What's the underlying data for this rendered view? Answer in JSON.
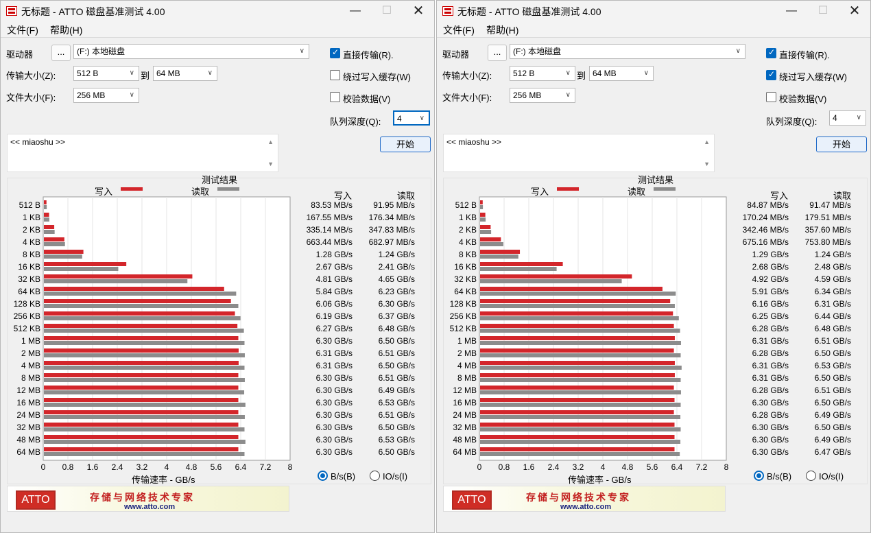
{
  "windows": [
    {
      "title": "无标题 - ATTO 磁盘基准测试 4.00",
      "menu": [
        "文件(F)",
        "帮助(H)"
      ],
      "drive_label": "驱动器",
      "browse_label": "...",
      "drive_value": "(F:) 本地磁盘",
      "transfer_size_label": "传输大小(Z):",
      "transfer_from": "512 B",
      "to_label": "到",
      "transfer_to": "64 MB",
      "file_size_label": "文件大小(F):",
      "file_size": "256 MB",
      "direct_io_label": "直接传输(R).",
      "direct_io_checked": true,
      "bypass_cache_label": "绕过写入缓存(W)",
      "bypass_cache_checked": false,
      "verify_label": "校验数据(V)",
      "verify_checked": false,
      "queue_depth_label": "队列深度(Q):",
      "queue_depth": "4",
      "start_label": "开始",
      "description": "<< miaoshu >>",
      "results_title": "测试结果",
      "write_label": "写入",
      "read_label": "读取",
      "col_write": "写入",
      "col_read": "读取",
      "xlabel": "传输速率 - GB/s",
      "radio_bps": "B/s(B)",
      "radio_ios": "IO/s(I)",
      "radio_selected": "bps",
      "banner_slogan": "存储与网络技术专家",
      "banner_logo": "ATTO",
      "banner_url": "www.atto.com",
      "chart_data": {
        "type": "bar",
        "orientation": "horizontal",
        "categories": [
          "512 B",
          "1 KB",
          "2 KB",
          "4 KB",
          "8 KB",
          "16 KB",
          "32 KB",
          "64 KB",
          "128 KB",
          "256 KB",
          "512 KB",
          "1 MB",
          "2 MB",
          "4 MB",
          "8 MB",
          "12 MB",
          "16 MB",
          "24 MB",
          "32 MB",
          "48 MB",
          "64 MB"
        ],
        "series": [
          {
            "name": "写入",
            "color": "#d3262b",
            "values": [
              0.084,
              0.168,
              0.335,
              0.663,
              1.28,
              2.67,
              4.81,
              5.84,
              6.06,
              6.19,
              6.27,
              6.3,
              6.31,
              6.31,
              6.3,
              6.3,
              6.3,
              6.3,
              6.3,
              6.3,
              6.3
            ]
          },
          {
            "name": "读取",
            "color": "#8c8c8c",
            "values": [
              0.092,
              0.176,
              0.348,
              0.683,
              1.24,
              2.41,
              4.65,
              6.23,
              6.3,
              6.37,
              6.48,
              6.5,
              6.51,
              6.5,
              6.51,
              6.49,
              6.53,
              6.51,
              6.5,
              6.53,
              6.5
            ]
          }
        ],
        "write_text": [
          "83.53 MB/s",
          "167.55 MB/s",
          "335.14 MB/s",
          "663.44 MB/s",
          "1.28 GB/s",
          "2.67 GB/s",
          "4.81 GB/s",
          "5.84 GB/s",
          "6.06 GB/s",
          "6.19 GB/s",
          "6.27 GB/s",
          "6.30 GB/s",
          "6.31 GB/s",
          "6.31 GB/s",
          "6.30 GB/s",
          "6.30 GB/s",
          "6.30 GB/s",
          "6.30 GB/s",
          "6.30 GB/s",
          "6.30 GB/s",
          "6.30 GB/s"
        ],
        "read_text": [
          "91.95 MB/s",
          "176.34 MB/s",
          "347.83 MB/s",
          "682.97 MB/s",
          "1.24 GB/s",
          "2.41 GB/s",
          "4.65 GB/s",
          "6.23 GB/s",
          "6.30 GB/s",
          "6.37 GB/s",
          "6.48 GB/s",
          "6.50 GB/s",
          "6.51 GB/s",
          "6.50 GB/s",
          "6.51 GB/s",
          "6.49 GB/s",
          "6.53 GB/s",
          "6.51 GB/s",
          "6.50 GB/s",
          "6.53 GB/s",
          "6.50 GB/s"
        ],
        "xticks": [
          "0",
          "0.8",
          "1.6",
          "2.4",
          "3.2",
          "4",
          "4.8",
          "5.6",
          "6.4",
          "7.2",
          "8"
        ],
        "xlim": [
          0,
          8
        ],
        "xlabel": "传输速率 - GB/s",
        "grid": true
      }
    },
    {
      "title": "无标题 - ATTO 磁盘基准测试 4.00",
      "menu": [
        "文件(F)",
        "帮助(H)"
      ],
      "drive_label": "驱动器",
      "browse_label": "...",
      "drive_value": "(F:) 本地磁盘",
      "transfer_size_label": "传输大小(Z):",
      "transfer_from": "512 B",
      "to_label": "到",
      "transfer_to": "64 MB",
      "file_size_label": "文件大小(F):",
      "file_size": "256 MB",
      "direct_io_label": "直接传输(R).",
      "direct_io_checked": true,
      "bypass_cache_label": "绕过写入缓存(W)",
      "bypass_cache_checked": true,
      "verify_label": "校验数据(V)",
      "verify_checked": false,
      "queue_depth_label": "队列深度(Q):",
      "queue_depth": "4",
      "start_label": "开始",
      "description": "<< miaoshu >>",
      "results_title": "测试结果",
      "write_label": "写入",
      "read_label": "读取",
      "col_write": "写入",
      "col_read": "读取",
      "xlabel": "传输速率 - GB/s",
      "radio_bps": "B/s(B)",
      "radio_ios": "IO/s(I)",
      "radio_selected": "bps",
      "banner_slogan": "存储与网络技术专家",
      "banner_logo": "ATTO",
      "banner_url": "www.atto.com",
      "chart_data": {
        "type": "bar",
        "orientation": "horizontal",
        "categories": [
          "512 B",
          "1 KB",
          "2 KB",
          "4 KB",
          "8 KB",
          "16 KB",
          "32 KB",
          "64 KB",
          "128 KB",
          "256 KB",
          "512 KB",
          "1 MB",
          "2 MB",
          "4 MB",
          "8 MB",
          "12 MB",
          "16 MB",
          "24 MB",
          "32 MB",
          "48 MB",
          "64 MB"
        ],
        "series": [
          {
            "name": "写入",
            "color": "#d3262b",
            "values": [
              0.085,
              0.17,
              0.342,
              0.675,
              1.29,
              2.68,
              4.92,
              5.91,
              6.16,
              6.25,
              6.28,
              6.31,
              6.28,
              6.31,
              6.31,
              6.28,
              6.3,
              6.28,
              6.3,
              6.3,
              6.3
            ]
          },
          {
            "name": "读取",
            "color": "#8c8c8c",
            "values": [
              0.091,
              0.18,
              0.358,
              0.754,
              1.24,
              2.48,
              4.59,
              6.34,
              6.31,
              6.44,
              6.48,
              6.51,
              6.5,
              6.53,
              6.5,
              6.51,
              6.5,
              6.49,
              6.5,
              6.49,
              6.47
            ]
          }
        ],
        "write_text": [
          "84.87 MB/s",
          "170.24 MB/s",
          "342.46 MB/s",
          "675.16 MB/s",
          "1.29 GB/s",
          "2.68 GB/s",
          "4.92 GB/s",
          "5.91 GB/s",
          "6.16 GB/s",
          "6.25 GB/s",
          "6.28 GB/s",
          "6.31 GB/s",
          "6.28 GB/s",
          "6.31 GB/s",
          "6.31 GB/s",
          "6.28 GB/s",
          "6.30 GB/s",
          "6.28 GB/s",
          "6.30 GB/s",
          "6.30 GB/s",
          "6.30 GB/s"
        ],
        "read_text": [
          "91.47 MB/s",
          "179.51 MB/s",
          "357.60 MB/s",
          "753.80 MB/s",
          "1.24 GB/s",
          "2.48 GB/s",
          "4.59 GB/s",
          "6.34 GB/s",
          "6.31 GB/s",
          "6.44 GB/s",
          "6.48 GB/s",
          "6.51 GB/s",
          "6.50 GB/s",
          "6.53 GB/s",
          "6.50 GB/s",
          "6.51 GB/s",
          "6.50 GB/s",
          "6.49 GB/s",
          "6.50 GB/s",
          "6.49 GB/s",
          "6.47 GB/s"
        ],
        "xticks": [
          "0",
          "0.8",
          "1.6",
          "2.4",
          "3.2",
          "4",
          "4.8",
          "5.6",
          "6.4",
          "7.2",
          "8"
        ],
        "xlim": [
          0,
          8
        ],
        "xlabel": "传输速率 - GB/s",
        "grid": true
      }
    }
  ]
}
